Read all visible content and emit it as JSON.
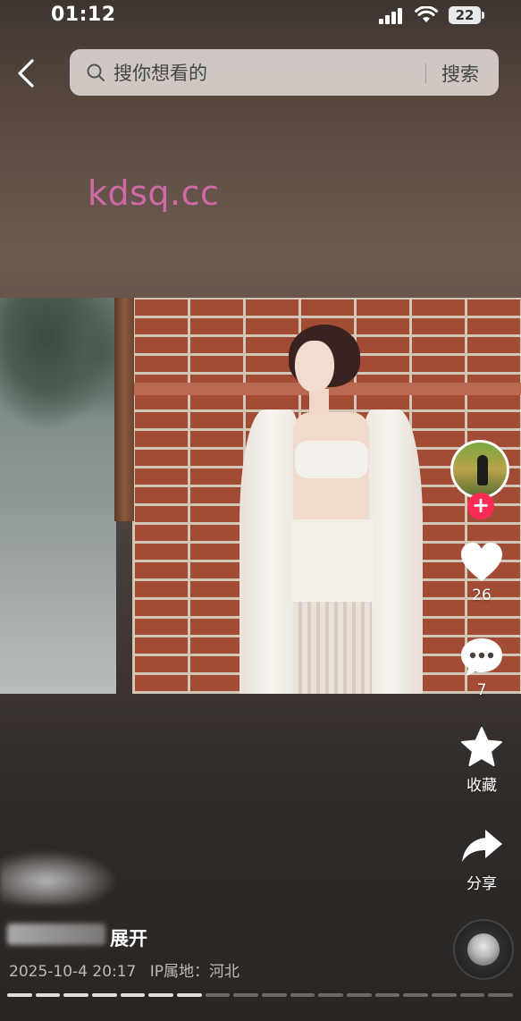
{
  "status_bar": {
    "time": "01:12",
    "battery": "22"
  },
  "search": {
    "placeholder": "搜你想看的",
    "button_label": "搜索"
  },
  "watermark": "kdsq.cc",
  "actions": {
    "like_count": "26",
    "comment_count": "7",
    "favorite_label": "收藏",
    "share_label": "分享"
  },
  "caption": {
    "expand_label": "展开"
  },
  "meta": {
    "date": "2025-10-4 20:17",
    "ip_location": "IP属地：河北"
  },
  "icons": {
    "back": "chevron-left-icon",
    "search": "search-icon",
    "like": "heart-icon",
    "comment": "comment-icon",
    "favorite": "star-icon",
    "share": "share-arrow-icon",
    "follow": "plus-icon"
  },
  "colors": {
    "accent": "#fe2c55",
    "watermark": "#d06aa6"
  },
  "progress": {
    "total_segments": 18,
    "filled_segments": 7
  }
}
